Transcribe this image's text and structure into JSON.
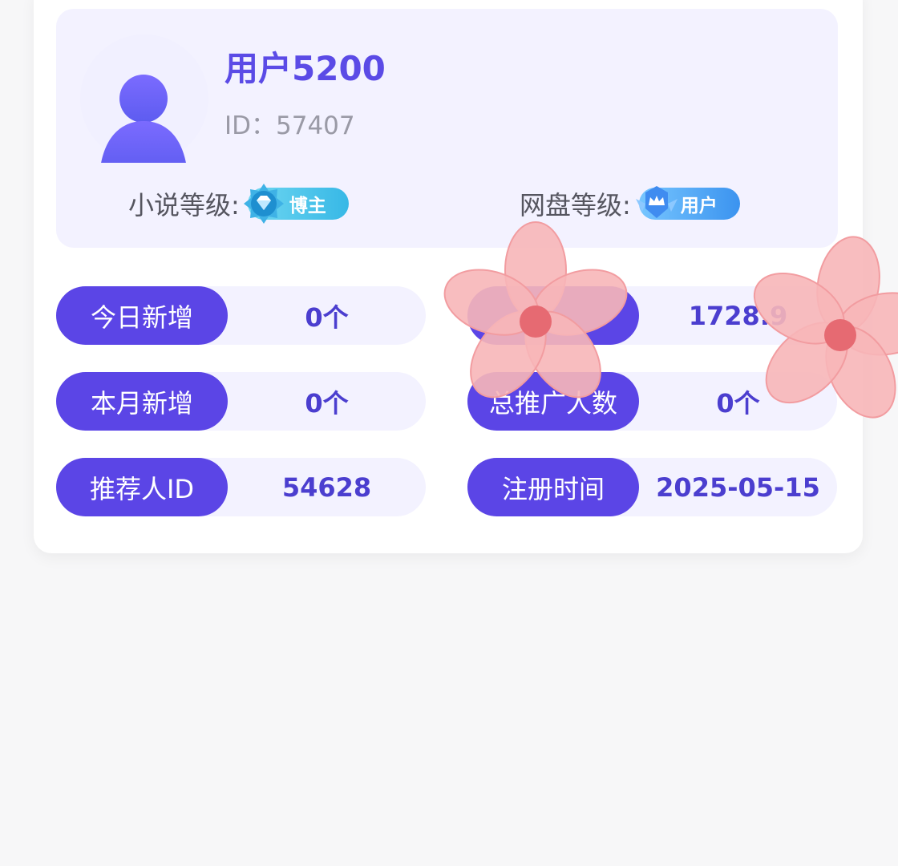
{
  "profile": {
    "username": "用户5200",
    "user_id": "ID：57407",
    "avatar_icon": "user-avatar-icon",
    "novel_level": {
      "label": "小说等级:",
      "badge": "博主",
      "icon": "diamond-badge-icon"
    },
    "pan_level": {
      "label": "网盘等级:",
      "badge": "用户",
      "icon": "crown-badge-icon"
    }
  },
  "stats": [
    {
      "label": "今日新增",
      "value": "0个"
    },
    {
      "label": "",
      "value": "1728.9"
    },
    {
      "label": "本月新增",
      "value": "0个"
    },
    {
      "label": "总推广人数",
      "value": "0个"
    },
    {
      "label": "推荐人ID",
      "value": "54628"
    },
    {
      "label": "注册时间",
      "value": "2025-05-15"
    }
  ],
  "colors": {
    "accent": "#5b45e6",
    "accent_text": "#4b3ecf",
    "panel": "#f3f2ff",
    "card": "#ffffff",
    "background": "#f7f7f8",
    "flower_sticker": "#f7b9bb"
  },
  "overlays": [
    "flower-sticker-icon",
    "flower-sticker-icon"
  ]
}
